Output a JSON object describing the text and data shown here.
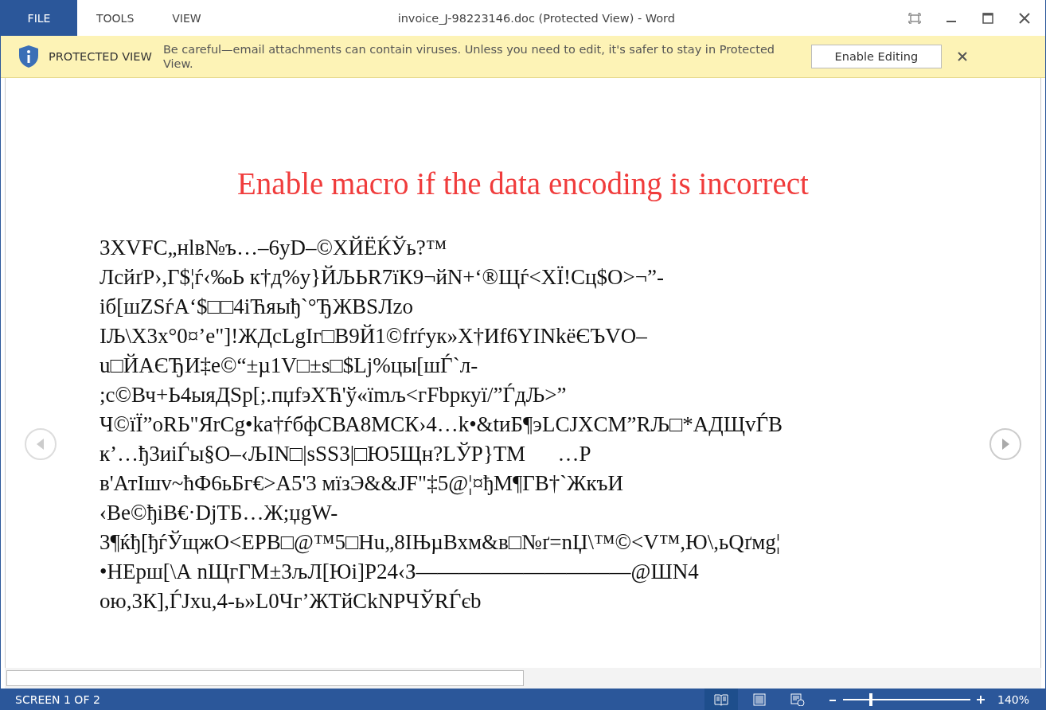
{
  "window": {
    "title": "invoice_J-98223146.doc (Protected View) - Word"
  },
  "tabs": [
    {
      "label": "FILE",
      "kind": "file"
    },
    {
      "label": "TOOLS",
      "kind": "menu"
    },
    {
      "label": "VIEW",
      "kind": "menu"
    }
  ],
  "protected_bar": {
    "label": "PROTECTED VIEW",
    "message": "Be careful—email attachments can contain viruses. Unless you need to edit, it's safer to stay in Protected View.",
    "button": "Enable Editing"
  },
  "document": {
    "heading": "Enable macro if the data encoding is incorrect",
    "lines": [
      "3XVFC„нlв№ъ…–6yD–©ХЙЁЌЎь?™",
      "ЛсйґР›,Г$¦ѓ‹‰Ь к†д%у}ЙЉЬR7їК9¬йN+‘®Щѓ<ХЇ!Сц$О>¬”-",
      "іб[шZSѓА‘$□□4іЋяыђ`°ЂЖВSЛzo",
      "ІЉ\\Х3х°0¤’е\"]!ЖДсLgІг□В9Й1©fґѓук»Х†Иf6YІNkёЄЪVО–",
      "u□ЙАЄЂИ‡е©“±µ1V□±s□$Lj%цы[шЃ`л-",
      ";с©Вч+Ь4ыяДSр[;.пџfэХЋ'ў«ïmљ<гFbркуї/”ЃдЉ>”",
      "Ч©їЇ”оRЬ\"ЯrCg•ka†ѓбфСВА8МСК›4…k•&tиБ¶эLCJXCM”RЉ□*АДЩvЃВ",
      "к’…ђ3иіЃы§О–‹ЉIN□|sSS3|□Ю5Щн?LЎР}ТМ      …Р",
      "в'АтІшv~ћФ6ьБг€>А5'3 мїзЭ&&JF\"‡5@¦¤ђМ¶ГВ†`ЖкъИ",
      "‹Ве©ђiВ€·DjТБ…Ж;џgW-",
      "3¶ќђ[ђѓЎщжО<ЕРВ□@™5□Hu„8IЊµВхм&в□№ґ=nЏ\\™©<V™,Ю\\,ьQґмg¦",
      "•НЕрш[\\А nЩгГМ±3љЛ[Юi]Р24‹З——————————@ШN4",
      "ою,3К],ЃJxu,4-ь»L0Чг’ЖТйСkNРЧЎRЃєb"
    ]
  },
  "status_bar": {
    "page": "SCREEN 1 OF 2",
    "views": [
      {
        "kind": "read",
        "selected": true
      },
      {
        "kind": "print",
        "selected": false
      },
      {
        "kind": "web",
        "selected": false
      }
    ],
    "zoom": {
      "level": 0.22,
      "reading": "140%"
    }
  }
}
